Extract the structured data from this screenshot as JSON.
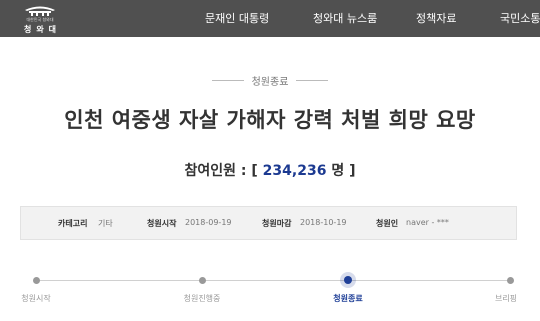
{
  "header": {
    "logo_sub": "대한민국 청와대",
    "logo_name": "청와대",
    "nav": [
      "문재인 대통령",
      "청와대 뉴스룸",
      "정책자료",
      "국민소통"
    ]
  },
  "petition": {
    "status": "청원종료",
    "title": "인천 여중생 자살 가해자 강력 처벌 희망 요망",
    "count_label": "참여인원 : [",
    "count_value": "234,236",
    "count_suffix": "명 ]",
    "info": [
      {
        "key": "카테고리",
        "value": "기타"
      },
      {
        "key": "청원시작",
        "value": "2018-09-19"
      },
      {
        "key": "청원마감",
        "value": "2018-10-19"
      },
      {
        "key": "청원인",
        "value": "naver - ***"
      }
    ]
  },
  "progress": {
    "steps": [
      "청원시작",
      "청원진행중",
      "청원종료",
      "브리핑"
    ],
    "active_index": 2
  },
  "colors": {
    "topbar": "#505050",
    "accent": "#1f3f97"
  }
}
